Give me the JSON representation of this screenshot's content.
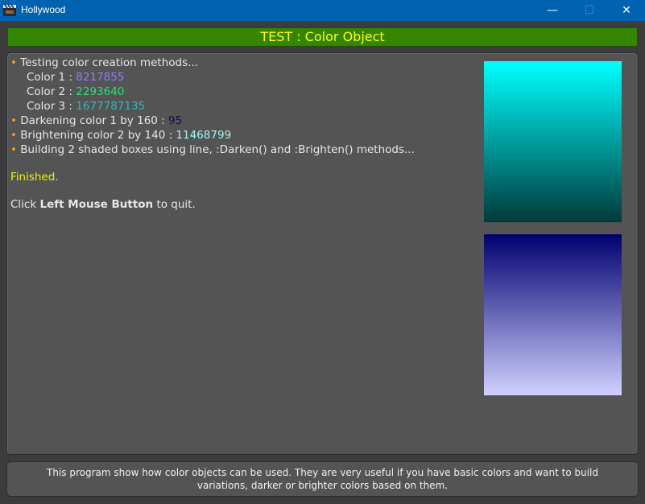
{
  "window": {
    "title": "Hollywood",
    "minimize_glyph": "—",
    "maximize_glyph": "☐",
    "close_glyph": "✕",
    "app_icon": "clapperboard-icon"
  },
  "header": {
    "title": "TEST : Color Object"
  },
  "log": {
    "bullet": "•",
    "line1": "Testing color creation methods...",
    "color1_label": "Color 1 : ",
    "color1_value": "8217855",
    "color2_label": "Color 2 : ",
    "color2_value": "2293640",
    "color3_label": "Color 3 : ",
    "color3_value": "1677787135",
    "darken_label": "Darkening color 1 by 160 : ",
    "darken_value": "95",
    "brighten_label": "Brightening color 2 by 140 : ",
    "brighten_value": "11468799",
    "building": "Building 2 shaded boxes using line, :Darken() and :Brighten() methods...",
    "finished": "Finished.",
    "click_prefix": "Click ",
    "click_bold": "Left Mouse Button",
    "click_suffix": " to quit."
  },
  "boxes": {
    "box1_top_color": "#00ffff",
    "box1_bottom_color": "#003b3b",
    "box2_top_color": "#000070",
    "box2_bottom_color": "#d0d0ff"
  },
  "footer": {
    "text": "This program show how color objects can be used. They are very useful if you have basic colors and want to build variations, darker or brighter colors based on them."
  },
  "colors": {
    "titlebar": "#0063b1",
    "header_bg": "#338600",
    "header_text": "#ffff00",
    "panel_bg": "#545454",
    "bullet": "#ff9c1a"
  }
}
